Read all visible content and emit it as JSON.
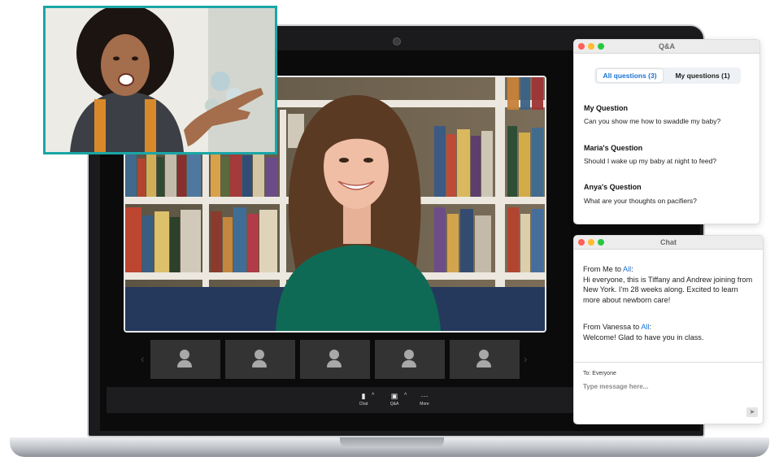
{
  "qa_panel": {
    "title": "Q&A",
    "tabs": [
      {
        "label": "All questions (3)",
        "active": true
      },
      {
        "label": "My questions (1)",
        "active": false
      }
    ],
    "questions": [
      {
        "title": "My Question",
        "text": "Can you show me how to swaddle my baby?"
      },
      {
        "title": "Maria's Question",
        "text": "Should I wake up my baby at night to feed?"
      },
      {
        "title": "Anya's Question",
        "text": "What are your thoughts on pacifiers?"
      }
    ]
  },
  "chat_panel": {
    "title": "Chat",
    "messages": [
      {
        "prefix": "From Me to ",
        "recipient": "All",
        "suffix": ":",
        "body": "Hi everyone, this is Tiffany and Andrew joining from New York. I'm 28 weeks along. Excited to learn more about newborn care!"
      },
      {
        "prefix": "From Vanessa to ",
        "recipient": "All",
        "suffix": ":",
        "body": "Welcome! Glad to have you in class."
      }
    ],
    "to_label": "To: Everyone",
    "input_placeholder": "Type message here..."
  },
  "toolbar": {
    "chat_label": "Chat",
    "qa_label": "Q&A",
    "more_label": "More",
    "caret": "^",
    "more_glyph": "···"
  },
  "thumbnails": {
    "count": 5,
    "prev_arrow": "‹",
    "next_arrow": "›"
  },
  "colors": {
    "accent_blue": "#1b73d4",
    "selfie_border": "#19a6a6",
    "traffic_red": "#fe5f57",
    "traffic_yellow": "#febc2e",
    "traffic_green": "#28c840"
  }
}
